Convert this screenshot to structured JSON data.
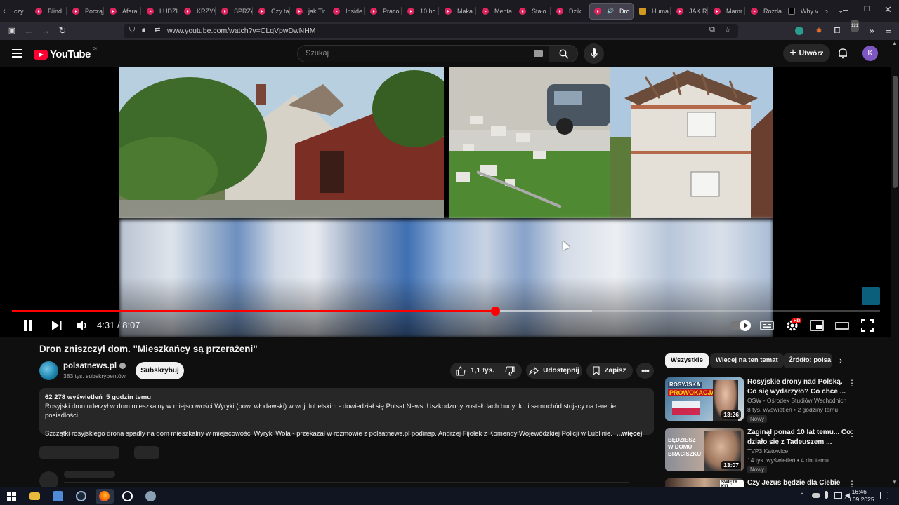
{
  "browser": {
    "tabs": [
      {
        "label": "czy",
        "icon": "chevron-left-icon"
      },
      {
        "label": "Blind",
        "icon": "youtube-icon"
      },
      {
        "label": "Począ",
        "icon": "youtube-icon"
      },
      {
        "label": "Afera",
        "icon": "youtube-icon"
      },
      {
        "label": "LUDZI",
        "icon": "youtube-icon"
      },
      {
        "label": "KRZYV",
        "icon": "youtube-icon"
      },
      {
        "label": "SPRZĄ",
        "icon": "youtube-icon"
      },
      {
        "label": "Czy ta",
        "icon": "youtube-icon"
      },
      {
        "label": "jak Tir",
        "icon": "youtube-icon"
      },
      {
        "label": "Inside",
        "icon": "youtube-icon"
      },
      {
        "label": "Praco",
        "icon": "youtube-icon"
      },
      {
        "label": "10 ho",
        "icon": "youtube-icon"
      },
      {
        "label": "Maka",
        "icon": "youtube-icon"
      },
      {
        "label": "Menta",
        "icon": "youtube-icon"
      },
      {
        "label": "Stało",
        "icon": "youtube-icon"
      },
      {
        "label": "Dziki",
        "icon": "youtube-icon"
      },
      {
        "label": "Dro",
        "icon": "youtube-icon",
        "active": true
      },
      {
        "label": "Huma",
        "icon": "amber-site-icon"
      },
      {
        "label": "JAK R",
        "icon": "youtube-icon"
      },
      {
        "label": "Mamr",
        "icon": "youtube-icon"
      },
      {
        "label": "Rozda",
        "icon": "youtube-icon"
      },
      {
        "label": "Why v",
        "icon": "x-icon"
      }
    ],
    "url": "www.youtube.com/watch?v=CLqVpwDwNHM",
    "notification_count": "121"
  },
  "yt": {
    "logo_text": "YouTube",
    "country_code": "PL",
    "search_placeholder": "Szukaj",
    "create_label": "Utwórz",
    "avatar_letter": "K"
  },
  "player": {
    "current_time": "4:31",
    "separator": "/",
    "duration": "8:07",
    "played_fraction": 0.557,
    "buffered_fraction": 0.668,
    "hd_badge": "HD"
  },
  "video": {
    "title": "Dron zniszczył dom. \"Mieszkańcy są przerażeni\"",
    "channel": "polsatnews.pl",
    "subscribers": "383 tys. subskrybentów",
    "subscribe_label": "Subskrybuj",
    "likes": "1,1 tys.",
    "share_label": "Udostępnij",
    "save_label": "Zapisz",
    "views": "62 278 wyświetleń",
    "age": "5 godzin temu",
    "desc_line1": "Rosyjski dron uderzył w dom mieszkalny w miejscowości Wyryki (pow. włodawski) w woj. lubelskim - dowiedział się Polsat News. Uszkodzony został dach budynku i samochód stojący na terenie posiadłości.",
    "desc_line2": "Szczątki rosyjskiego drona spadły na dom mieszkalny w miejscowości Wyryki Wola - przekazał w rozmowie z polsatnews.pl podinsp. Andrzej Fijołek z Komendy Wojewódzkiej Policji w Lublinie.",
    "more_label": "...więcej"
  },
  "sidebar": {
    "chips": [
      "Wszystkie",
      "Więcej na ten temat",
      "Źródło: polsa"
    ],
    "recommendations": [
      {
        "title": "Rosyjskie drony nad Polską. Co się wydarzyło? Co chce ...",
        "channel": "OSW - Ośrodek Studiów Wschodnich",
        "meta": "8 tys. wyświetleń • 2 godziny temu",
        "badge": "Nowy",
        "duration": "13:26",
        "thumb_text_1": "ROSYJSKA",
        "thumb_text_2": "PROWOKACJA"
      },
      {
        "title": "Zaginął ponad 10 lat temu... Co działo się z Tadeuszem ...",
        "channel": "TVP3 Katowice",
        "meta": "14 tys. wyświetleń • 4 dni temu",
        "badge": "Nowy",
        "duration": "13:07",
        "thumb_text_1": "BĘDZIESZ",
        "thumb_text_2": "W DOMU",
        "thumb_text_3": "BRACISZKU"
      },
      {
        "title": "Czy Jezus będzie dla Ciebie",
        "thumb_text_1": "ŚWIĘTY KIJ"
      }
    ]
  },
  "taskbar": {
    "time": "16:46",
    "date": "10.09.2025"
  }
}
